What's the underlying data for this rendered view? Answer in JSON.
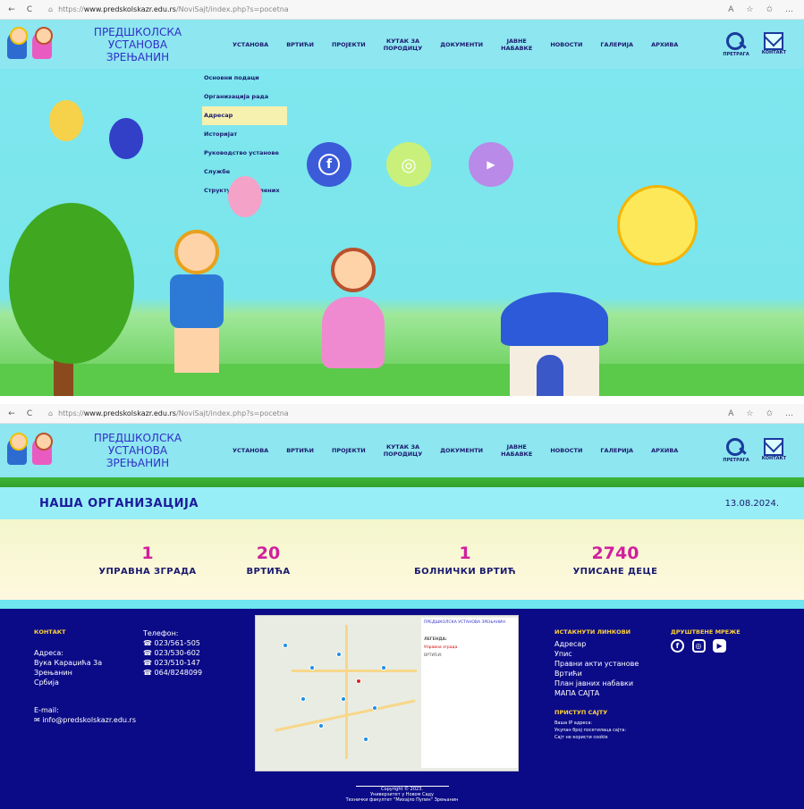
{
  "browser": {
    "url_top_prefix": "https://",
    "url_top_domain": "www.predskolskazr.edu.rs",
    "url_top_path": "/NoviSajt/index.php?s=pocetna",
    "url_bottom_prefix": "https://",
    "url_bottom_domain": "www.predskolskazr.edu.rs",
    "url_bottom_path": "/NoviSajt/index.php?s=pocetna"
  },
  "header": {
    "name_line1": "ПРЕДШКОЛСКА УСТАНОВА",
    "name_line2": "ЗРЕЊАНИН",
    "menu": [
      {
        "l1": "УСТАНОВА",
        "l2": ""
      },
      {
        "l1": "ВРТИЋИ",
        "l2": ""
      },
      {
        "l1": "ПРОЈЕКТИ",
        "l2": ""
      },
      {
        "l1": "КУТАК ЗА",
        "l2": "ПОРОДИЦУ"
      },
      {
        "l1": "ДОКУМЕНТИ",
        "l2": ""
      },
      {
        "l1": "ЈАВНЕ",
        "l2": "НАБАВКЕ"
      },
      {
        "l1": "НОВОСТИ",
        "l2": ""
      },
      {
        "l1": "ГАЛЕРИЈА",
        "l2": ""
      },
      {
        "l1": "АРХИВА",
        "l2": ""
      }
    ],
    "search_label": "ПРЕТРАГА",
    "contact_label": "КОНТАКТ"
  },
  "dropdown": {
    "items": [
      "Основни подаци",
      "Организација рада",
      "Адресар",
      "Историјат",
      "Руководство установе",
      "Службе",
      "Структура запослених"
    ],
    "active_index": 2
  },
  "social_hero": [
    {
      "icon": "facebook-icon",
      "glyph": "f",
      "color": "#3b5bd8"
    },
    {
      "icon": "instagram-icon",
      "glyph": "◎",
      "color": "#c9f07a"
    },
    {
      "icon": "youtube-icon",
      "glyph": "▶",
      "color": "#b98ae8"
    }
  ],
  "org": {
    "title": "НАША ОРГАНИЗАЦИЈА",
    "date": "13.08.2024."
  },
  "stats": [
    {
      "number": "1",
      "label": "УПРАВНА ЗГРАДА"
    },
    {
      "number": "20",
      "label": "ВРТИЋА"
    },
    {
      "number": "1",
      "label": "БОЛНИЧКИ ВРТИЋ"
    },
    {
      "number": "2740",
      "label": "УПИСАНЕ ДЕЦЕ"
    }
  ],
  "footer": {
    "contact_heading": "КОНТАКТ",
    "address_label": "Адреса:",
    "address_lines": [
      "Вука Караџића 3а",
      "Зрењанин",
      "Србија"
    ],
    "email_label": "E-mail:",
    "email": "✉ info@predskolskazr.edu.rs",
    "phone_label": "Телефон:",
    "phones": [
      "☎ 023/561-505",
      "☎ 023/530-602",
      "☎ 023/510-147",
      "☎ 064/8248099"
    ],
    "links_heading": "ИСТАКНУТИ ЛИНКОВИ",
    "links": [
      "Адресар",
      "Упис",
      "Правни акти установе",
      "Вртићи",
      "План јавних набавки",
      "МАПА САЈТА"
    ],
    "access_heading": "ПРИСТУП САЈТУ",
    "access_lines": [
      "Ваша IP адреса:",
      "Укупан број посетилаца сајта:",
      "Сајт не користи cookie"
    ],
    "social_heading": "ДРУШТВЕНЕ МРЕЖЕ",
    "copyright": [
      "Copyright © 2023.",
      "Универзитет у Новом Саду",
      "Технички факултет \"Михајло Пупин\" Зрењанин"
    ],
    "map_legend_title": "ПРЕДШКОЛСКА УСТАНОВА ЗРЕЊАНИН",
    "map_legend_heading": "ЛЕГЕНДА:",
    "map_legend_admin": "Управна зграда",
    "map_legend_vrtici": "ВРТИЋИ:"
  },
  "colors": {
    "header_bg": "#8ee6f0",
    "accent_pink": "#d0209c",
    "navy": "#0b0b87"
  }
}
